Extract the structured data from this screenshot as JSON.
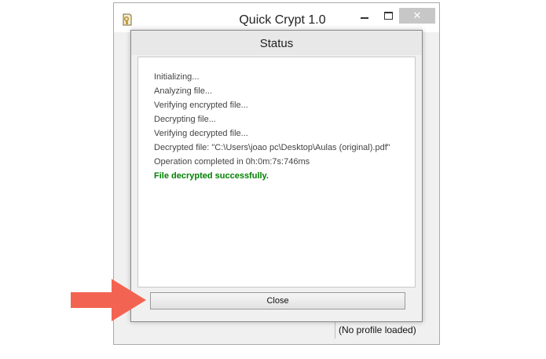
{
  "main_window": {
    "title": "Quick Crypt 1.0",
    "status_bar_text": "(No profile loaded)",
    "icons": {
      "app": "key-document-icon",
      "minimize": "minimize-icon",
      "maximize": "maximize-icon",
      "close": "close-icon"
    },
    "close_glyph": "✕"
  },
  "dialog": {
    "title": "Status",
    "log_lines": [
      "Initializing...",
      "Analyzing file...",
      "Verifying encrypted file...",
      "Decrypting file...",
      "Verifying decrypted file...",
      "Decrypted file: \"C:\\Users\\joao pc\\Desktop\\Aulas (original).pdf\"",
      "Operation completed in 0h:0m:7s:746ms"
    ],
    "success_message": "File decrypted successfully.",
    "close_button_label": "Close"
  },
  "annotation": {
    "arrow_color": "#f26451",
    "icon": "pointer-arrow-icon"
  },
  "colors": {
    "success": "#008000",
    "close_hover": "#c7c7c7"
  }
}
